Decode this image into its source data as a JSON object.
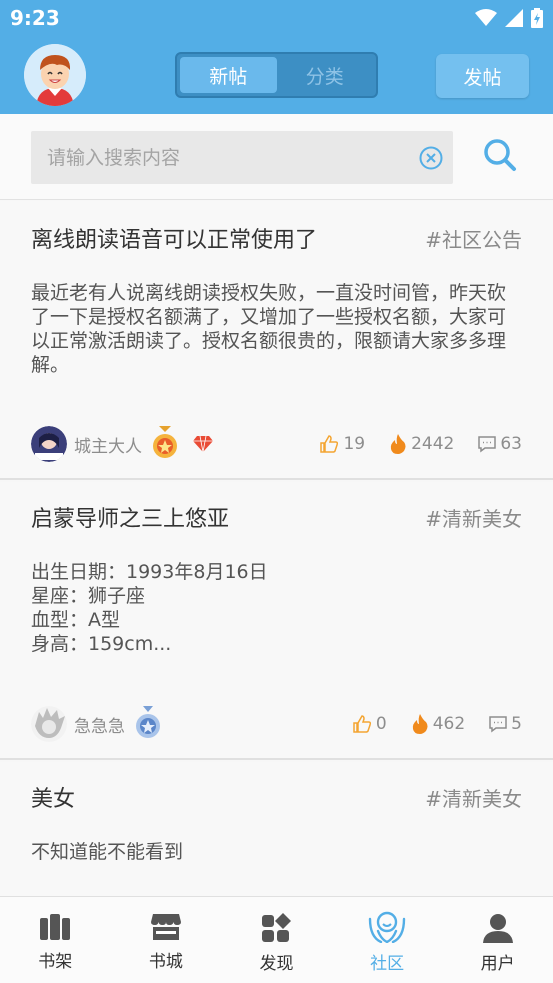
{
  "status": {
    "time": "9:23"
  },
  "header": {
    "tabs": [
      {
        "label": "新帖",
        "active": true
      },
      {
        "label": "分类",
        "active": false
      }
    ],
    "post_button": "发帖"
  },
  "search": {
    "placeholder": "请输入搜索内容",
    "value": ""
  },
  "posts": [
    {
      "title": "离线朗读语音可以正常使用了",
      "tag": "#社区公告",
      "body": "最近老有人说离线朗读授权失败，一直没时间管，昨天砍了一下是授权名额满了，又增加了一些授权名额，大家可以正常激活朗读了。授权名额很贵的，限额请大家多多理解。",
      "author": "城主大人",
      "likes": "19",
      "views": "2442",
      "comments": "63"
    },
    {
      "title": "启蒙导师之三上悠亚",
      "tag": "#清新美女",
      "body_lines": [
        "出生日期：1993年8月16日",
        "星座：狮子座",
        "血型：A型",
        "身高：159cm..."
      ],
      "author": "急急急",
      "likes": "0",
      "views": "462",
      "comments": "5"
    },
    {
      "title": "美女",
      "tag": "#清新美女",
      "body": "不知道能不能看到"
    }
  ],
  "nav": [
    {
      "label": "书架",
      "icon": "bookshelf-icon"
    },
    {
      "label": "书城",
      "icon": "store-icon"
    },
    {
      "label": "发现",
      "icon": "discover-icon"
    },
    {
      "label": "社区",
      "icon": "community-icon",
      "active": true
    },
    {
      "label": "用户",
      "icon": "user-icon"
    }
  ],
  "colors": {
    "primary": "#53aee6",
    "accent_orange": "#f4a532",
    "text_gray": "#8d8d8d"
  }
}
